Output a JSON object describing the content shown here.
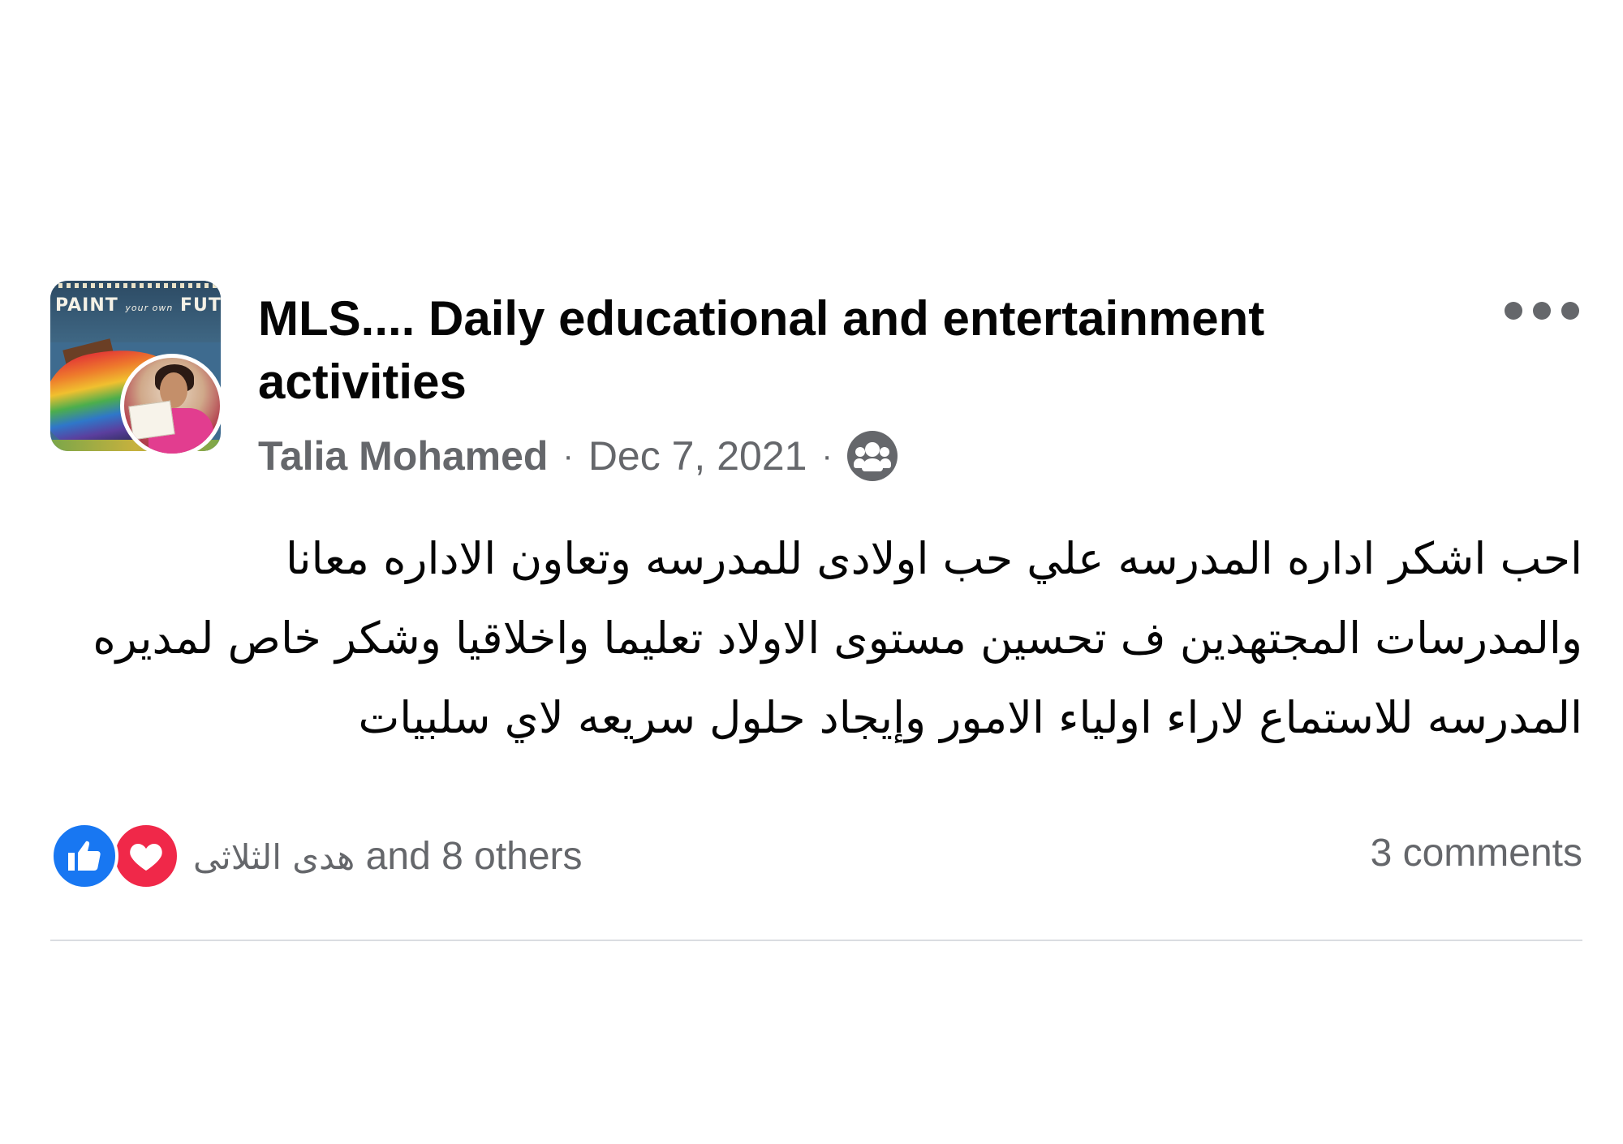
{
  "post": {
    "group_name": "MLS.... Daily educational and entertainment activities",
    "group_avatar_text": "PAINT your own FUTURE",
    "author": "Talia Mohamed",
    "separator": "·",
    "date": "Dec 7, 2021",
    "audience_icon": "group-members-icon",
    "more_icon": "more-dots-icon",
    "body": "احب اشكر اداره المدرسه علي حب اولادى للمدرسه وتعاون الاداره معانا والمدرسات المجتهدين ف تحسين مستوى الاولاد تعليما واخلاقيا وشكر خاص لمديره المدرسه للاستماع لاراء اولياء الامور وإيجاد حلول سريعه لاي سلبيات"
  },
  "reactions": {
    "icons": [
      "like-icon",
      "love-icon"
    ],
    "first_name": "هدى الثلاثى",
    "others_text": "and 8 others"
  },
  "comments": {
    "count_text": "3 comments"
  },
  "colors": {
    "text_primary": "#050505",
    "text_secondary": "#65676b",
    "like_blue": "#1877f2",
    "love_red": "#f02849",
    "divider": "#dadde1"
  }
}
